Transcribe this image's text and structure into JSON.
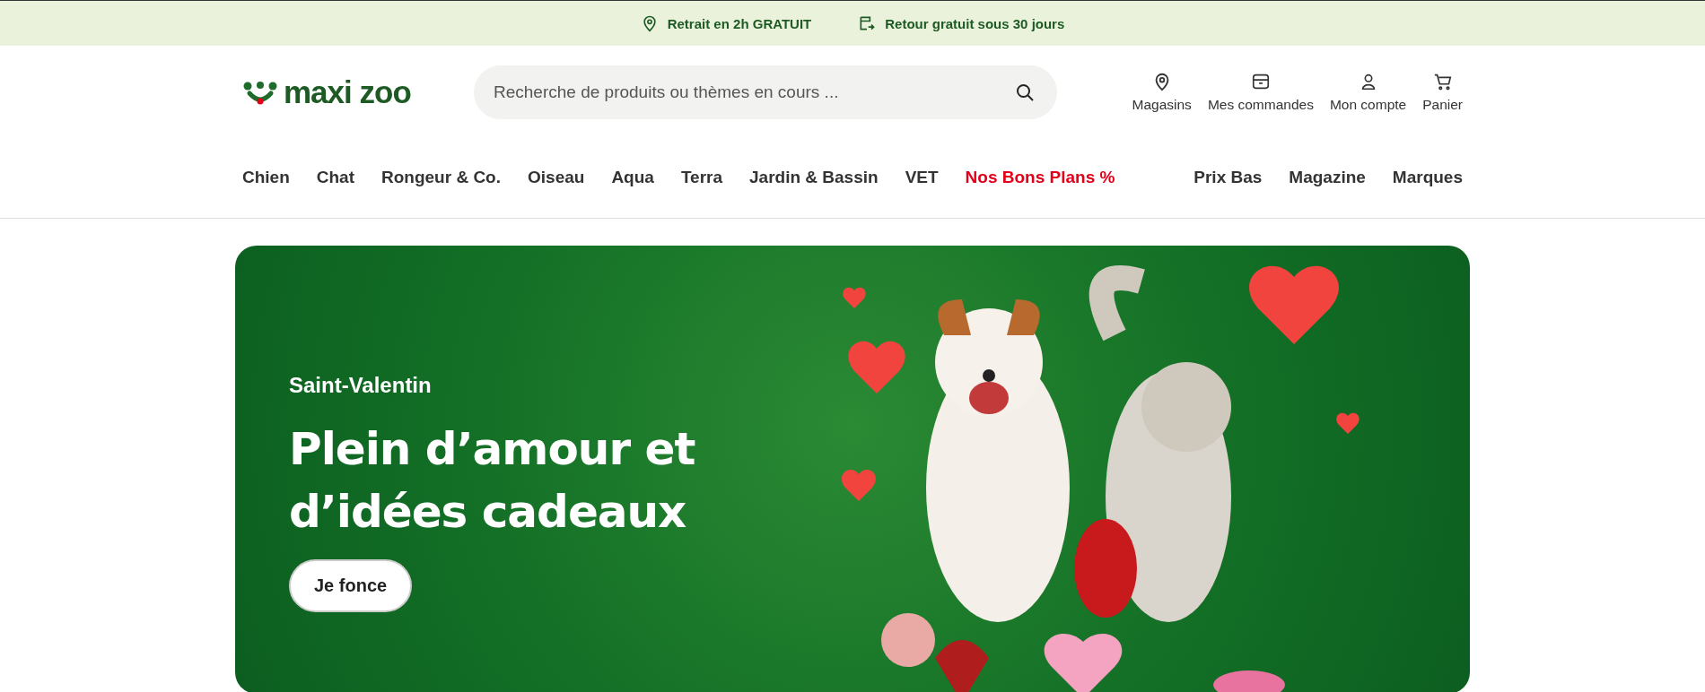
{
  "top_bar": [
    {
      "text": "Retrait en 2h GRATUIT"
    },
    {
      "text": "Retour gratuit sous 30 jours"
    }
  ],
  "logo": {
    "text": "maxi zoo"
  },
  "search": {
    "placeholder": "Recherche de produits ou thèmes en cours ..."
  },
  "header_actions": [
    {
      "label": "Magasins"
    },
    {
      "label": "Mes commandes"
    },
    {
      "label": "Mon compte"
    },
    {
      "label": "Panier"
    }
  ],
  "nav_left": [
    {
      "label": "Chien",
      "highlight": false
    },
    {
      "label": "Chat",
      "highlight": false
    },
    {
      "label": "Rongeur & Co.",
      "highlight": false
    },
    {
      "label": "Oiseau",
      "highlight": false
    },
    {
      "label": "Aqua",
      "highlight": false
    },
    {
      "label": "Terra",
      "highlight": false
    },
    {
      "label": "Jardin & Bassin",
      "highlight": false
    },
    {
      "label": "VET",
      "highlight": false
    },
    {
      "label": "Nos Bons Plans %",
      "highlight": true
    }
  ],
  "nav_right": [
    {
      "label": "Prix Bas",
      "highlight": false
    },
    {
      "label": "Magazine",
      "highlight": false
    },
    {
      "label": "Marques",
      "highlight": false
    }
  ],
  "hero": {
    "eyebrow": "Saint-Valentin",
    "headline": [
      "Plein d’amour et",
      "d’idées cadeaux"
    ],
    "button": "Je fonce"
  }
}
